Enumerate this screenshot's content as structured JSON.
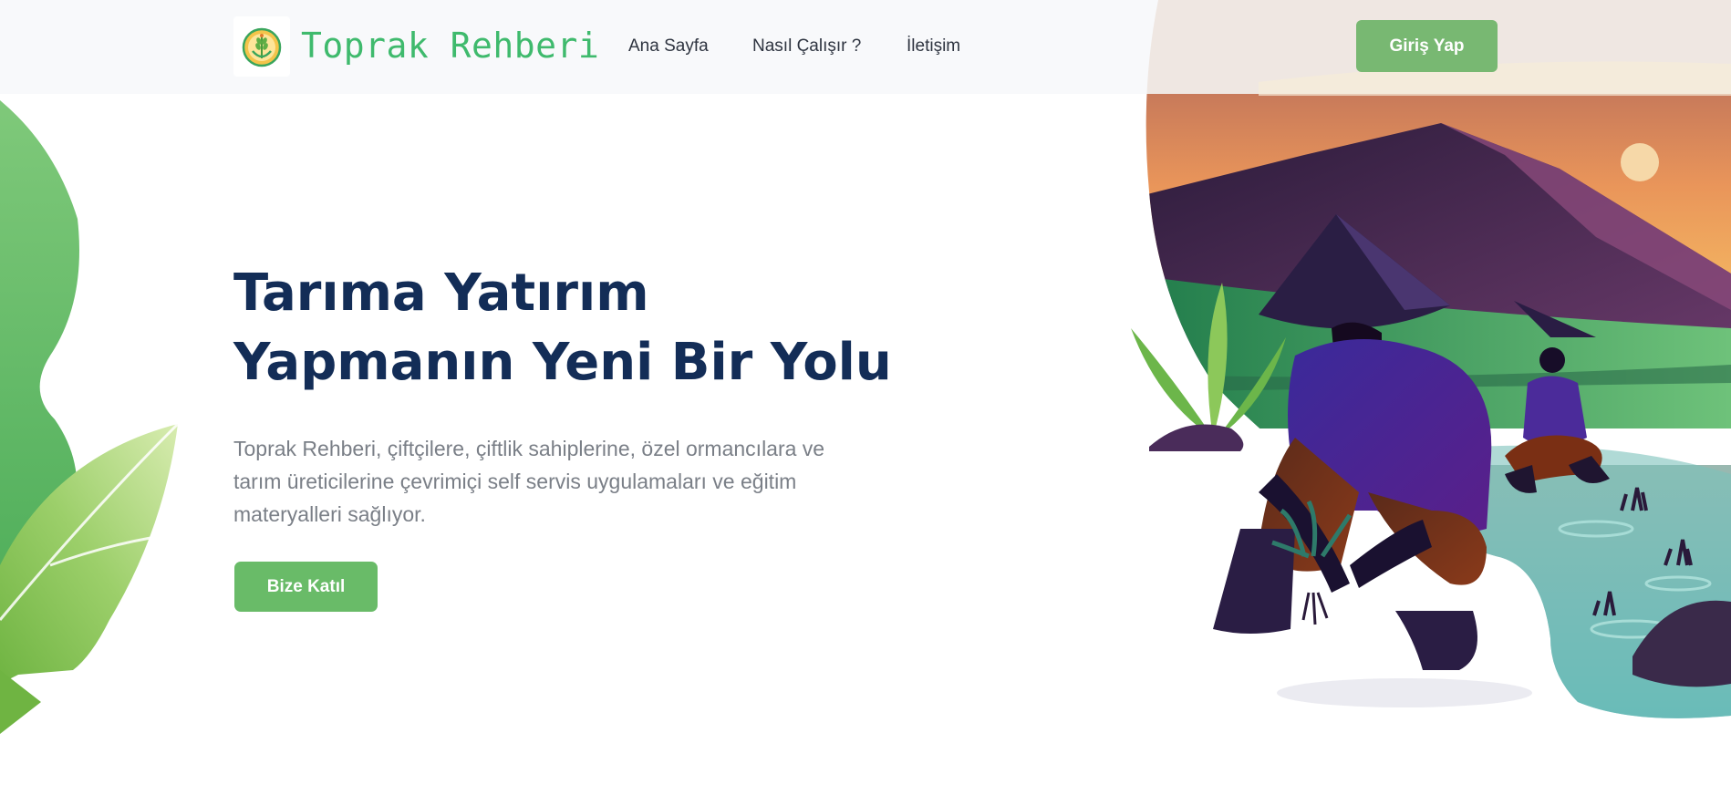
{
  "header": {
    "brand": "Toprak Rehberi",
    "logo_icon": "wheat-emblem-icon",
    "nav": [
      {
        "label": "Ana Sayfa"
      },
      {
        "label": "Nasıl Çalışır ?"
      },
      {
        "label": "İletişim"
      }
    ],
    "login_label": "Giriş Yap"
  },
  "hero": {
    "title_line1": "Tarıma Yatırım",
    "title_line2": "Yapmanın Yeni Bir Yolu",
    "description": "Toprak Rehberi, çiftçilere, çiftlik sahiplerine, özel ormancılara ve tarım üreticilerine çevrimiçi self servis uygulamaları ve eğitim materyalleri sağlıyor.",
    "cta_label": "Bize Katıl"
  },
  "colors": {
    "brand_green": "#3fba6d",
    "button_green": "#69bb68",
    "login_green": "#78b872",
    "title_navy": "#132d57"
  },
  "illustrations": {
    "left": "leaf-decoration-icon",
    "right": "farmers-planting-rice-illustration"
  }
}
